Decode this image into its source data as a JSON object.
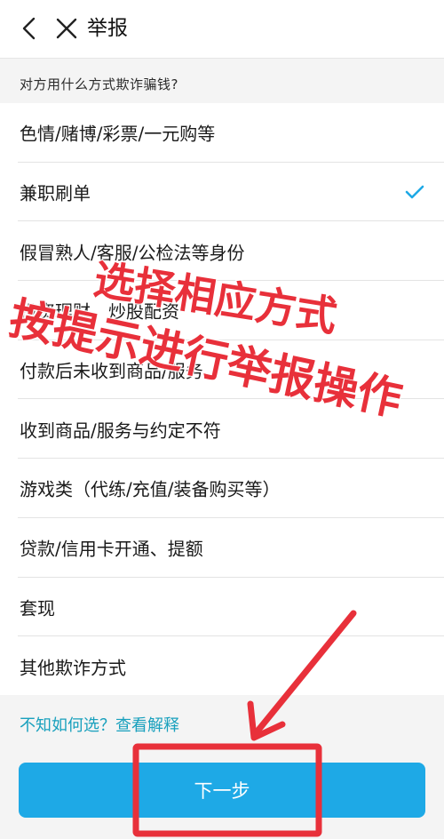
{
  "header": {
    "title": "举报",
    "back_icon": "chevron-left-icon",
    "close_icon": "close-icon"
  },
  "question": "对方用什么方式欺诈骗钱?",
  "options": [
    {
      "label": "色情/赌博/彩票/一元购等",
      "selected": false
    },
    {
      "label": "兼职刷单",
      "selected": true
    },
    {
      "label": "假冒熟人/客服/公检法等身份",
      "selected": false
    },
    {
      "label": "投资理财、炒股配资",
      "selected": false
    },
    {
      "label": "付款后未收到商品/服务",
      "selected": false
    },
    {
      "label": "收到商品/服务与约定不符",
      "selected": false
    },
    {
      "label": "游戏类（代练/充值/装备购买等）",
      "selected": false
    },
    {
      "label": "贷款/信用卡开通、提额",
      "selected": false
    },
    {
      "label": "套现",
      "selected": false
    },
    {
      "label": "其他欺诈方式",
      "selected": false
    }
  ],
  "help_link": "不知如何选？查看解释",
  "next_button": "下一步",
  "overlay": {
    "line1": "选择相应方式",
    "line2": "按提示进行举报操作"
  },
  "colors": {
    "accent": "#1ea9e6",
    "link": "#18a0bd",
    "check": "#1ea9e6",
    "annotation": "#e8303a"
  }
}
